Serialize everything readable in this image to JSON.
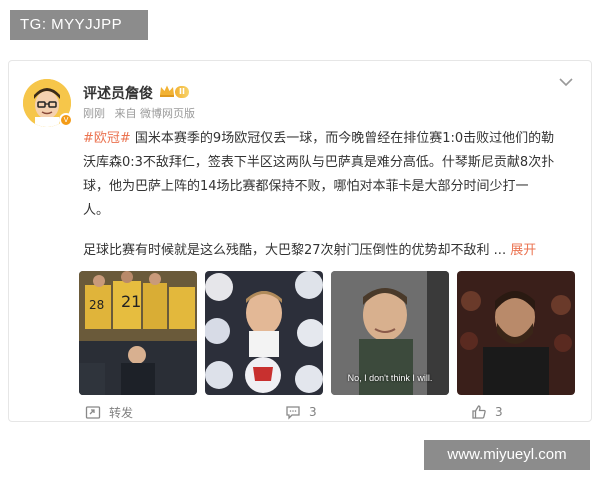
{
  "overlay": {
    "tg_label": "TG: MYYJJPP",
    "watermark": "www.miyueyl.com"
  },
  "post": {
    "user_name": "评述员詹俊",
    "level_badge": "II",
    "time": "刚刚",
    "source": "来自 微博网页版",
    "topic": "#欧冠#",
    "body_lines": [
      " 国米本赛季的9场欧冠仅丢一球，而今晚曾经在排位赛1:0击败过他们的勒",
      "沃库森0:3不敌拜仁，签表下半区这两队与巴萨真是难分高低。什琴斯尼贡献8次扑",
      "球，他为巴萨上阵的14场比赛都保持不败，哪怕对本菲卡是大部分时间少打一",
      "人。"
    ],
    "body_line_2": "足球比赛有时候就是这么残酷，大巴黎27次射门压倒性的优势却不敌利 ...",
    "expand_label": "展开",
    "images": [
      {
        "name": "photo-team-celebration",
        "caption": ""
      },
      {
        "name": "photo-kane-with-balls",
        "caption": ""
      },
      {
        "name": "photo-meme-szczesny",
        "caption": "No, I don't think I will."
      },
      {
        "name": "photo-alisson-crowd",
        "caption": ""
      }
    ],
    "actions": {
      "repost_label": "转发",
      "comment_count": "3",
      "like_count": "3"
    }
  },
  "icons": {
    "chevron": "chevron-down-icon",
    "repost": "repost-icon",
    "comment": "comment-icon",
    "like": "thumbs-up-icon",
    "crown": "crown-icon"
  },
  "colors": {
    "accent": "#eb7350",
    "meta": "#9a9a9a",
    "label_bg": "#8c8c8c"
  }
}
